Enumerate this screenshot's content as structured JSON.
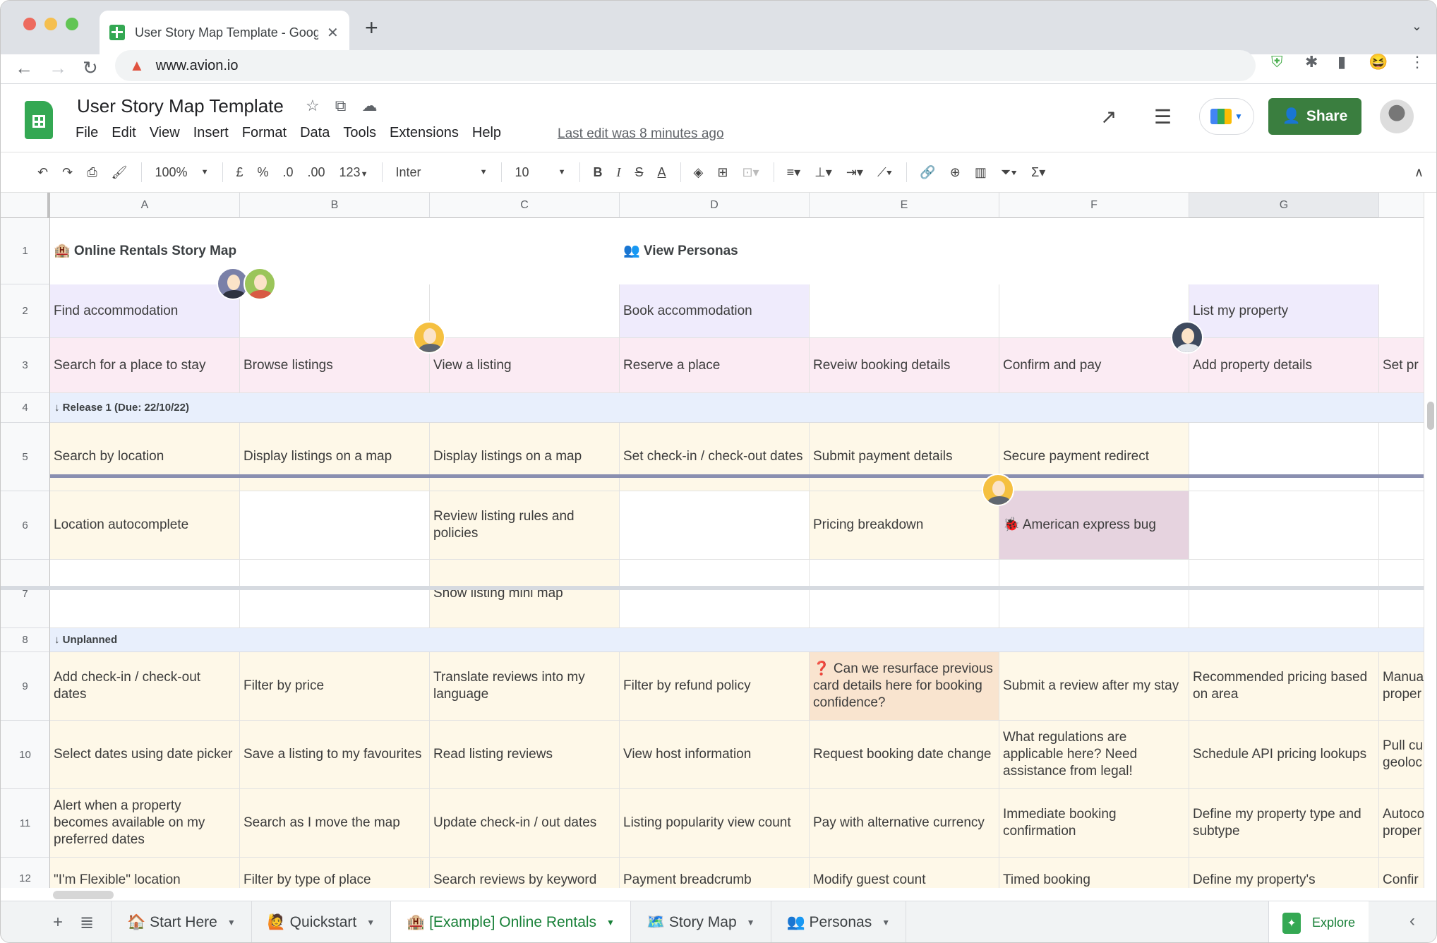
{
  "browser": {
    "tab_title": "User Story Map Template - Google Sheets",
    "new_tab_label": "+",
    "url": "www.avion.io"
  },
  "doc": {
    "title": "User Story Map Template",
    "menus": [
      "File",
      "Edit",
      "View",
      "Insert",
      "Format",
      "Data",
      "Tools",
      "Extensions",
      "Help"
    ],
    "last_edit": "Last edit was 8 minutes ago",
    "share_label": "Share"
  },
  "toolbar": {
    "zoom": "100%",
    "currency": "£",
    "percent": "%",
    "dec_decrease": ".0",
    "dec_increase": ".00",
    "number_format": "123",
    "font": "Inter",
    "font_size": "10"
  },
  "grid": {
    "columns": [
      "A",
      "B",
      "C",
      "D",
      "E",
      "F",
      "G",
      ""
    ],
    "selected_column": "G",
    "rows": [
      "1",
      "2",
      "3",
      "4",
      "5",
      "6",
      "7",
      "8",
      "9",
      "10",
      "11",
      "12"
    ],
    "title_cell": "🏨 Online Rentals Story Map",
    "personas_cell": "👥 View Personas",
    "activities": [
      "Find accommodation",
      "",
      "",
      "Book accommodation",
      "",
      "",
      "List my property",
      ""
    ],
    "steps": [
      "Search for a place to stay",
      "Browse listings",
      "View a listing",
      "Reserve a place",
      "Reveiw booking details",
      "Confirm and pay",
      "Add property details",
      "Set pr"
    ],
    "release_band": "↓ Release 1 (Due: 22/10/22)",
    "release_rows": [
      [
        "Search by location",
        "Display listings on a map",
        "Display listings on a map",
        "Set check-in / check-out dates",
        "Submit payment details",
        "Secure payment redirect",
        "",
        ""
      ],
      [
        "Location autocomplete",
        "",
        "Review listing rules and policies",
        "",
        "Pricing breakdown",
        "🐞 American express bug",
        "",
        ""
      ],
      [
        "",
        "",
        "Show listing mini map",
        "",
        "",
        "",
        "",
        ""
      ]
    ],
    "unplanned_band": "↓ Unplanned",
    "unplanned_rows": [
      [
        "Add check-in / check-out dates",
        "Filter by price",
        "Translate reviews into my language",
        "Filter by refund policy",
        "❓ Can we resurface previous card details here for booking confidence?",
        "Submit a review after my stay",
        "Recommended pricing based on area",
        "Manua proper"
      ],
      [
        "Select dates using date picker",
        "Save a listing to my favourites",
        "Read listing reviews",
        "View host information",
        "Request booking date change",
        "What regulations are applicable here? Need assistance from legal!",
        "Schedule API pricing lookups",
        "Pull cu geoloc"
      ],
      [
        "Alert when a property becomes available on my preferred dates",
        "Search as I move the map",
        "Update check-in / out dates",
        "Listing popularity view count",
        "Pay with alternative currency",
        "Immediate booking confirmation",
        "Define my property type and subtype",
        "Autoco proper"
      ],
      [
        "\"I'm Flexible\" location",
        "Filter by type of place",
        "Search reviews by keyword",
        "Payment breadcrumb",
        "Modify guest count",
        "Timed booking",
        "Define my property's",
        "Confir"
      ]
    ]
  },
  "colors": {
    "activity_bg": "#efebfc",
    "step_bg": "#fbebf3",
    "story_bg": "#fef8e8",
    "band_bg": "#e8effc",
    "bug_bg": "#e6d3df",
    "question_bg": "#f9e4cf",
    "share_bg": "#3a7e3f"
  },
  "sheet_tabs": [
    {
      "label": "🏠 Start Here",
      "active": false
    },
    {
      "label": "🙋 Quickstart",
      "active": false
    },
    {
      "label": "🏨 [Example] Online Rentals",
      "active": true
    },
    {
      "label": "🗺️ Story Map",
      "active": false
    },
    {
      "label": "👥 Personas",
      "active": false
    }
  ],
  "explore_label": "Explore"
}
